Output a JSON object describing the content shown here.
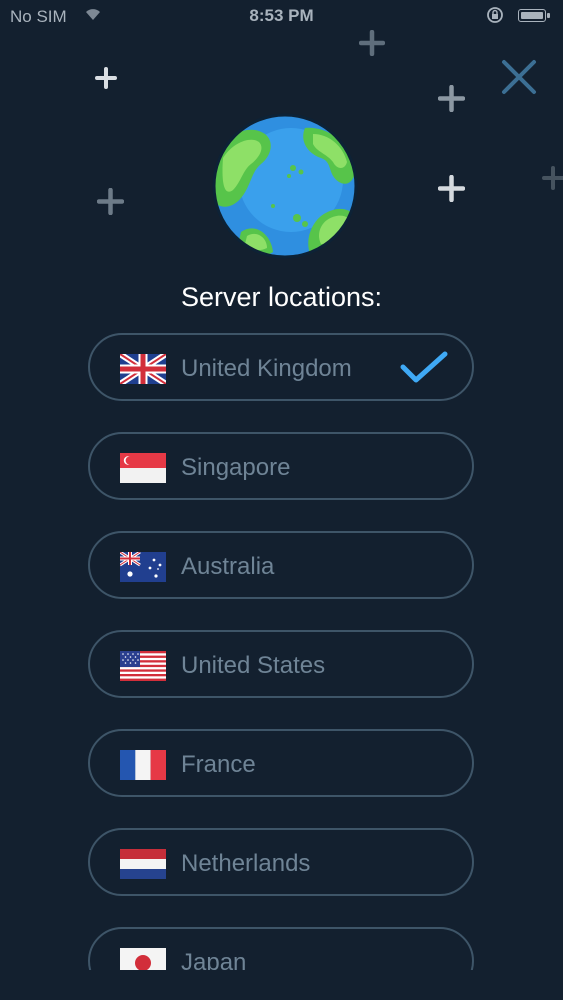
{
  "status_bar": {
    "carrier": "No SIM",
    "time": "8:53 PM"
  },
  "header": {
    "title": "Server locations:"
  },
  "locations": [
    {
      "name": "United Kingdom",
      "flag": "uk-flag",
      "selected": true
    },
    {
      "name": "Singapore",
      "flag": "singapore-flag",
      "selected": false
    },
    {
      "name": "Australia",
      "flag": "australia-flag",
      "selected": false
    },
    {
      "name": "United States",
      "flag": "us-flag",
      "selected": false
    },
    {
      "name": "France",
      "flag": "france-flag",
      "selected": false
    },
    {
      "name": "Netherlands",
      "flag": "netherlands-flag",
      "selected": false
    },
    {
      "name": "Japan",
      "flag": "japan-flag",
      "selected": false
    }
  ],
  "icons": {
    "close": "close-icon",
    "selected": "checkmark-icon",
    "hero": "globe-icon"
  },
  "colors": {
    "background": "#13202f",
    "accent": "#3fa9f5",
    "pill_border": "#3e5568",
    "label_text": "#6f8496",
    "title_text": "#ffffff"
  }
}
